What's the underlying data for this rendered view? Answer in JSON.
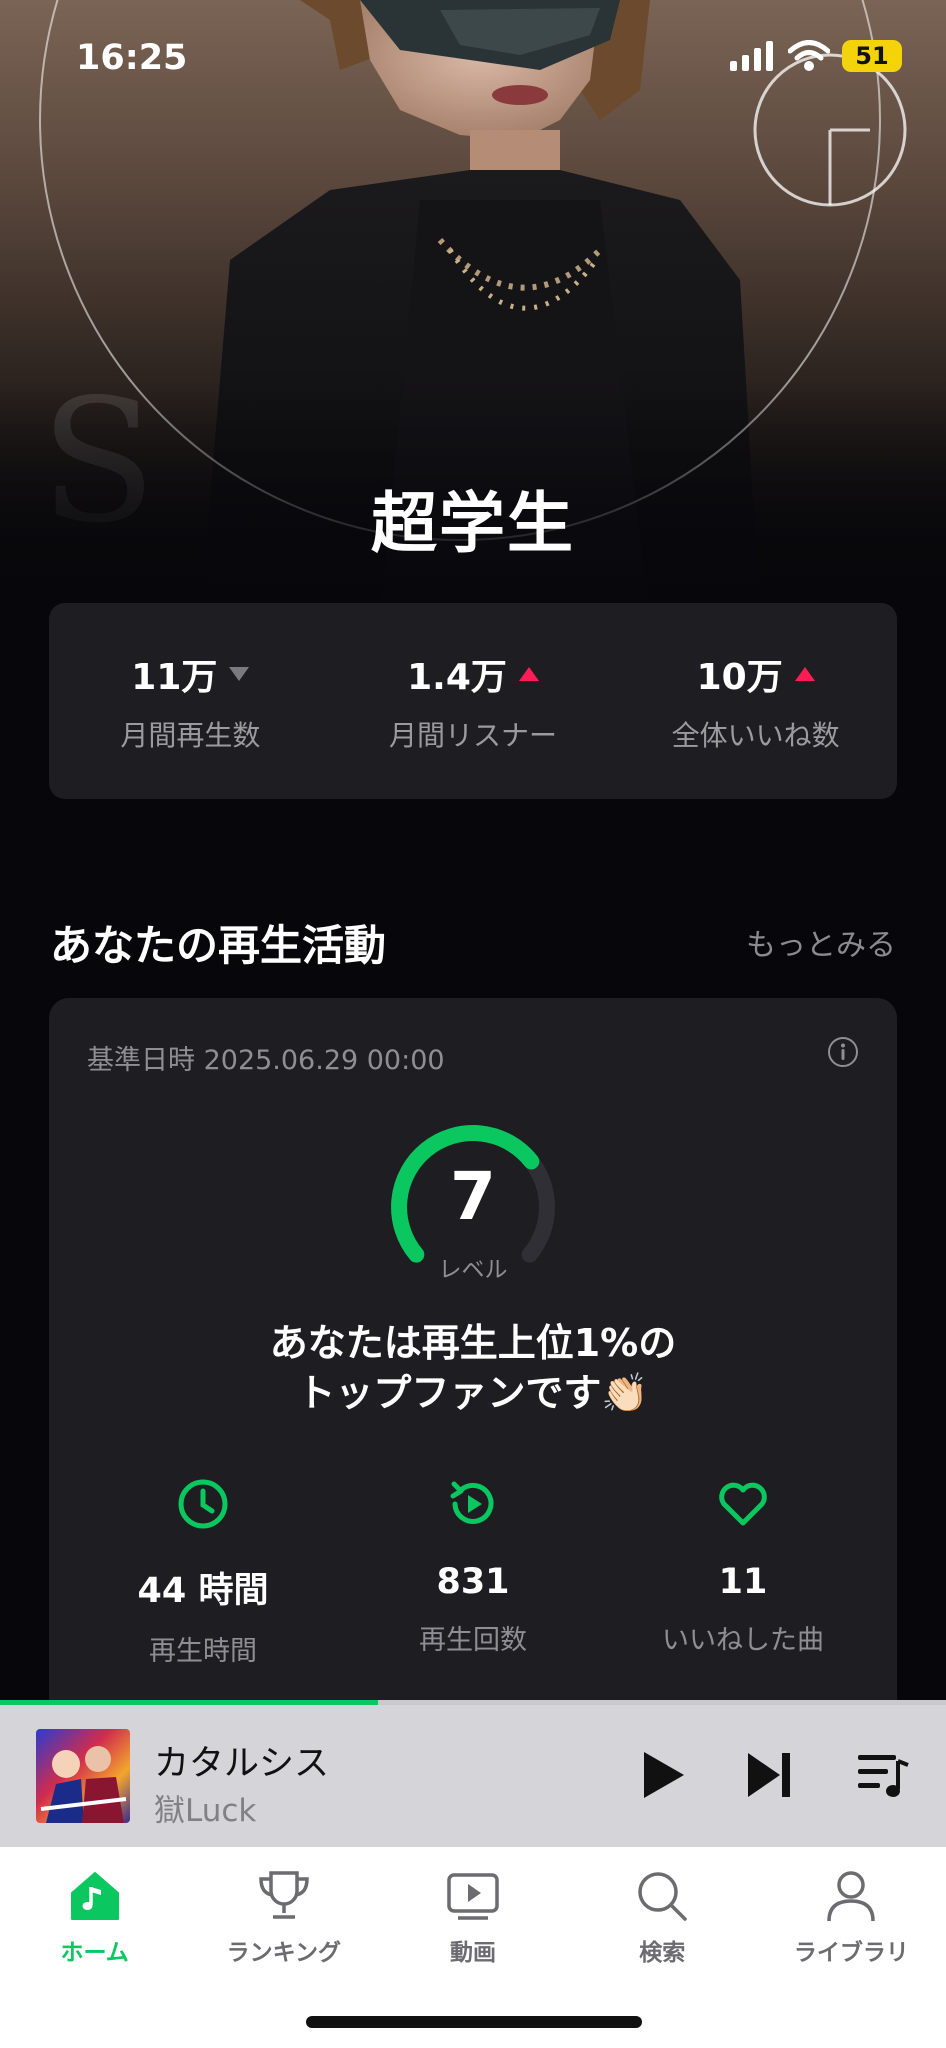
{
  "status_bar": {
    "time": "16:25",
    "battery": "51"
  },
  "artist": {
    "name": "超学生"
  },
  "stats": [
    {
      "value": "11万",
      "label": "月間再生数",
      "trend": "down"
    },
    {
      "value": "1.4万",
      "label": "月間リスナー",
      "trend": "up"
    },
    {
      "value": "10万",
      "label": "全体いいね数",
      "trend": "up"
    }
  ],
  "activity": {
    "title": "あなたの再生活動",
    "more": "もっとみる",
    "base_date": "基準日時 2025.06.29 00:00",
    "level": "7",
    "level_label": "レベル",
    "level_progress": 0.7,
    "message_line1": "あなたは再生上位1%の",
    "message_line2": "トップファンです👏🏻",
    "metrics": [
      {
        "icon": "clock-icon",
        "value": "44 時間",
        "label": "再生時間"
      },
      {
        "icon": "replay-icon",
        "value": "831",
        "label": "再生回数"
      },
      {
        "icon": "heart-icon",
        "value": "11",
        "label": "いいねした曲"
      }
    ]
  },
  "player": {
    "title": "カタルシス",
    "artist": "獄Luck",
    "progress": 0.4
  },
  "tabs": [
    {
      "label": "ホーム",
      "icon": "home-icon",
      "active": true
    },
    {
      "label": "ランキング",
      "icon": "trophy-icon",
      "active": false
    },
    {
      "label": "動画",
      "icon": "video-icon",
      "active": false
    },
    {
      "label": "検索",
      "icon": "search-icon",
      "active": false
    },
    {
      "label": "ライブラリ",
      "icon": "profile-icon",
      "active": false
    }
  ],
  "colors": {
    "accent": "#0bc75f",
    "up": "#ff1d55",
    "down": "#7a7a80",
    "card": "#1d1d22"
  }
}
